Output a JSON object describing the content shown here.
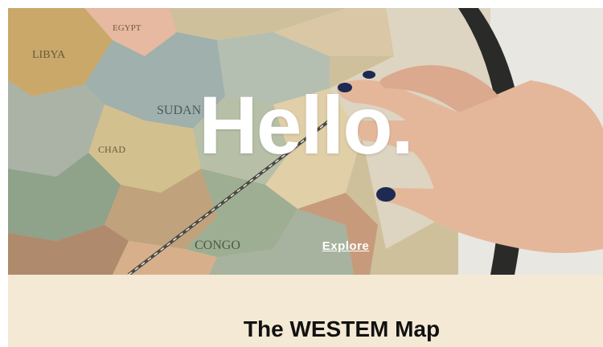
{
  "hero": {
    "title": "Hello.",
    "explore_link": "Explore",
    "map_labels": [
      "LIBYA",
      "SUDAN",
      "CHAD",
      "CONGO",
      "EGYPT"
    ]
  },
  "section": {
    "title": "The WESTEM Map"
  },
  "colors": {
    "page_bg": "#ffffff",
    "section_bg": "#f4e9d4",
    "hero_text": "#ffffff",
    "title_text": "#111111"
  }
}
